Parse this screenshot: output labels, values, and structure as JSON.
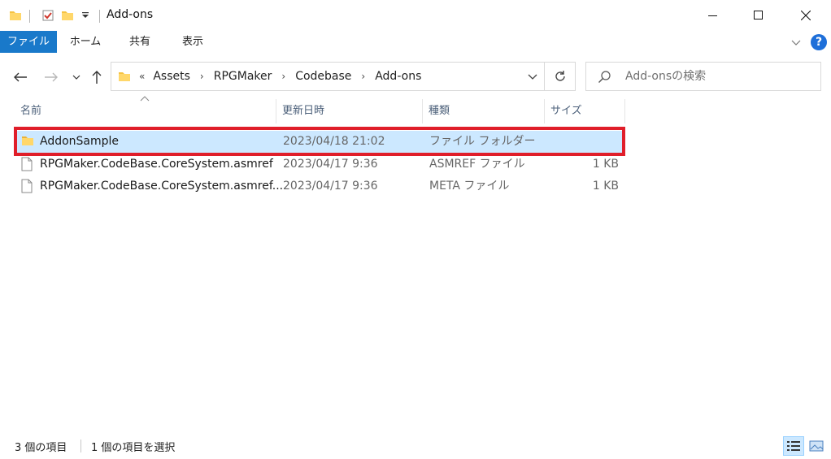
{
  "window": {
    "title": "Add-ons",
    "minimize_label": "─",
    "maximize_label": "☐",
    "close_label": "✕"
  },
  "ribbon": {
    "tabs": [
      {
        "label": "ファイル"
      },
      {
        "label": "ホーム"
      },
      {
        "label": "共有"
      },
      {
        "label": "表示"
      }
    ],
    "help_label": "?"
  },
  "address": {
    "overflow_label": "«",
    "breadcrumbs": [
      "Assets",
      "RPGMaker",
      "Codebase",
      "Add-ons"
    ]
  },
  "search": {
    "placeholder": "Add-onsの検索"
  },
  "columns": {
    "name": "名前",
    "date": "更新日時",
    "type": "種類",
    "size": "サイズ"
  },
  "files": [
    {
      "name": "AddonSample",
      "date": "2023/04/18 21:02",
      "type": "ファイル フォルダー",
      "size": "",
      "icon": "folder-icon"
    },
    {
      "name": "RPGMaker.CodeBase.CoreSystem.asmref",
      "date": "2023/04/17 9:36",
      "type": "ASMREF ファイル",
      "size": "1 KB",
      "icon": "file-icon"
    },
    {
      "name": "RPGMaker.CodeBase.CoreSystem.asmref....",
      "date": "2023/04/17 9:36",
      "type": "META ファイル",
      "size": "1 KB",
      "icon": "file-icon"
    }
  ],
  "status": {
    "item_count": "3 個の項目",
    "selection": "1 個の項目を選択"
  },
  "colors": {
    "accent": "#1979ca",
    "selection": "#cce8ff",
    "highlight_border": "#e01e2a",
    "folder": "#f5c242"
  }
}
